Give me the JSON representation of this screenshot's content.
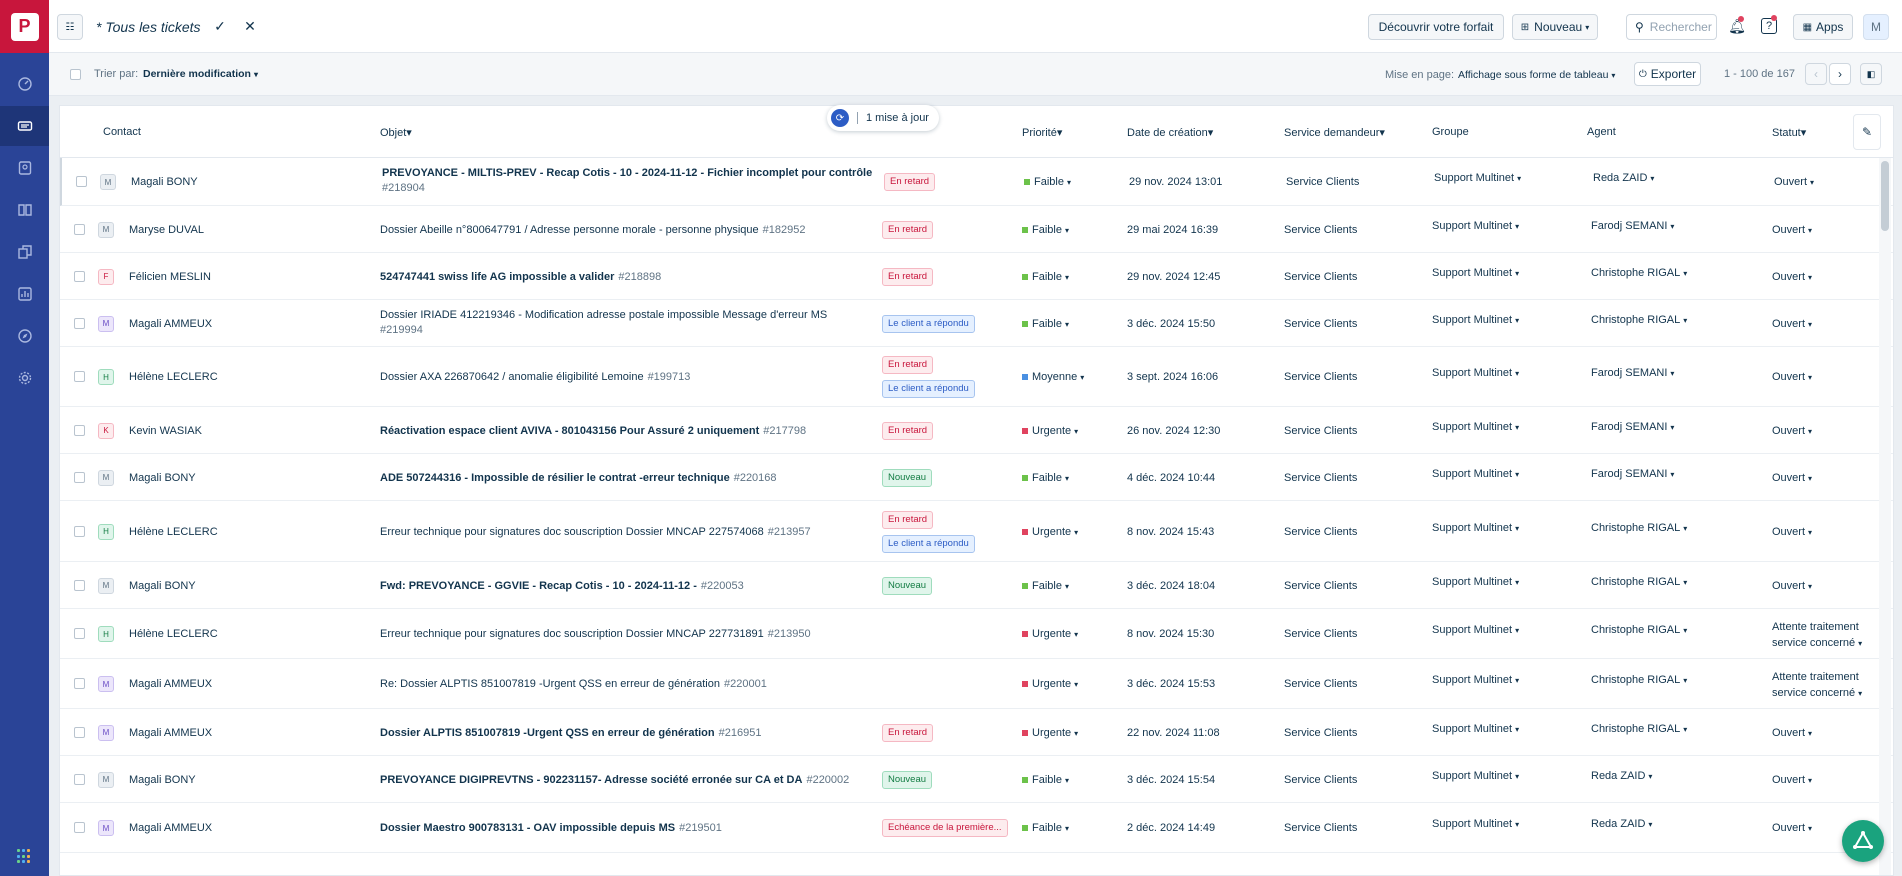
{
  "rail": {
    "logo_letter": "P",
    "items": [
      {
        "icon": "speedometer-icon"
      },
      {
        "icon": "tickets-icon",
        "active": true
      },
      {
        "icon": "contacts-icon"
      },
      {
        "icon": "book-icon"
      },
      {
        "icon": "copy-icon"
      },
      {
        "icon": "chart-icon"
      },
      {
        "icon": "compass-icon"
      },
      {
        "icon": "gear-icon"
      }
    ]
  },
  "topbar": {
    "view_title": "* Tous les tickets",
    "discover_plan": "Découvrir votre forfait",
    "new_label": "Nouveau",
    "search_placeholder": "Rechercher",
    "apps_label": "Apps",
    "avatar_letter": "M"
  },
  "subbar": {
    "sort_label": "Trier par:",
    "sort_value": "Dernière modification",
    "layout_label": "Mise en page:",
    "layout_value": "Affichage sous forme de tableau",
    "export_label": "Exporter",
    "pagination": "1 - 100 de 167"
  },
  "update_pill": {
    "text": "1 mise à jour"
  },
  "columns": {
    "contact": "Contact",
    "objet": "Objet",
    "priorite": "Priorité",
    "date": "Date de création",
    "service": "Service demandeur",
    "groupe": "Groupe",
    "agent": "Agent",
    "statut": "Statut"
  },
  "colors": {
    "late": "#c8163c",
    "reply": "#2c5cc5",
    "new": "#137c43",
    "faible": "#6cc24a",
    "moyenne": "#4a90e2",
    "urgente": "#e0435f"
  },
  "rows": [
    {
      "initial": "M",
      "avatar": "grey",
      "contact": "Magali BONY",
      "subject": "PREVOYANCE - MILTIS-PREV - Recap Cotis - 10 - 2024-11-12 - Fichier incomplet pour contrôle",
      "id": "#218904",
      "bold": true,
      "tags": [
        {
          "t": "En retard",
          "k": "late"
        }
      ],
      "priority": "Faible",
      "pk": "faible",
      "date": "29 nov. 2024 13:01",
      "service": "Service Clients",
      "group": "Support Multinet",
      "agent": "Reda ZAID",
      "status": "Ouvert"
    },
    {
      "initial": "M",
      "avatar": "grey",
      "contact": "Maryse DUVAL",
      "subject": "Dossier Abeille n°800647791 / Adresse personne morale - personne physique",
      "id": "#182952",
      "bold": false,
      "tags": [
        {
          "t": "En retard",
          "k": "late"
        }
      ],
      "priority": "Faible",
      "pk": "faible",
      "date": "29 mai 2024 16:39",
      "service": "Service Clients",
      "group": "Support Multinet",
      "agent": "Farodj SEMANI",
      "status": "Ouvert"
    },
    {
      "initial": "F",
      "avatar": "red",
      "contact": "Félicien MESLIN",
      "subject": "524747441 swiss life AG impossible a valider",
      "id": "#218898",
      "bold": true,
      "tags": [
        {
          "t": "En retard",
          "k": "late"
        }
      ],
      "priority": "Faible",
      "pk": "faible",
      "date": "29 nov. 2024 12:45",
      "service": "Service Clients",
      "group": "Support Multinet",
      "agent": "Christophe RIGAL",
      "status": "Ouvert"
    },
    {
      "initial": "M",
      "avatar": "purple",
      "contact": "Magali AMMEUX",
      "subject": "Dossier IRIADE 412219346 - Modification adresse postale impossible Message d'erreur MS",
      "id": "#219994",
      "bold": false,
      "tags": [
        {
          "t": "Le client a répondu",
          "k": "reply"
        }
      ],
      "priority": "Faible",
      "pk": "faible",
      "date": "3 déc. 2024 15:50",
      "service": "Service Clients",
      "group": "Support Multinet",
      "agent": "Christophe RIGAL",
      "status": "Ouvert"
    },
    {
      "initial": "H",
      "avatar": "green",
      "contact": "Hélène LECLERC",
      "subject": "Dossier AXA 226870642 / anomalie éligibilité Lemoine",
      "id": "#199713",
      "bold": false,
      "tags": [
        {
          "t": "En retard",
          "k": "late"
        },
        {
          "t": "Le client a répondu",
          "k": "reply"
        }
      ],
      "priority": "Moyenne",
      "pk": "moyenne",
      "date": "3 sept. 2024 16:06",
      "service": "Service Clients",
      "group": "Support Multinet",
      "agent": "Farodj SEMANI",
      "status": "Ouvert"
    },
    {
      "initial": "K",
      "avatar": "red",
      "contact": "Kevin WASIAK",
      "subject": "Réactivation espace client AVIVA - 801043156 Pour Assuré 2 uniquement",
      "id": "#217798",
      "bold": true,
      "tags": [
        {
          "t": "En retard",
          "k": "late"
        }
      ],
      "priority": "Urgente",
      "pk": "urgente",
      "date": "26 nov. 2024 12:30",
      "service": "Service Clients",
      "group": "Support Multinet",
      "agent": "Farodj SEMANI",
      "status": "Ouvert"
    },
    {
      "initial": "M",
      "avatar": "grey",
      "contact": "Magali BONY",
      "subject": "ADE 507244316 - Impossible de résilier le contrat -erreur technique",
      "id": "#220168",
      "bold": true,
      "tags": [
        {
          "t": "Nouveau",
          "k": "new"
        }
      ],
      "priority": "Faible",
      "pk": "faible",
      "date": "4 déc. 2024 10:44",
      "service": "Service Clients",
      "group": "Support Multinet",
      "agent": "Farodj SEMANI",
      "status": "Ouvert"
    },
    {
      "initial": "H",
      "avatar": "green",
      "contact": "Hélène LECLERC",
      "subject": "Erreur technique pour signatures doc souscription Dossier MNCAP 227574068",
      "id": "#213957",
      "bold": false,
      "tags": [
        {
          "t": "En retard",
          "k": "late"
        },
        {
          "t": "Le client a répondu",
          "k": "reply"
        }
      ],
      "priority": "Urgente",
      "pk": "urgente",
      "date": "8 nov. 2024 15:43",
      "service": "Service Clients",
      "group": "Support Multinet",
      "agent": "Christophe RIGAL",
      "status": "Ouvert"
    },
    {
      "initial": "M",
      "avatar": "grey",
      "contact": "Magali BONY",
      "subject": "Fwd: PREVOYANCE - GGVIE - Recap Cotis - 10 - 2024-11-12 -",
      "id": "#220053",
      "bold": true,
      "tags": [
        {
          "t": "Nouveau",
          "k": "new"
        }
      ],
      "priority": "Faible",
      "pk": "faible",
      "date": "3 déc. 2024 18:04",
      "service": "Service Clients",
      "group": "Support Multinet",
      "agent": "Christophe RIGAL",
      "status": "Ouvert"
    },
    {
      "initial": "H",
      "avatar": "green",
      "contact": "Hélène LECLERC",
      "subject": "Erreur technique pour signatures doc souscription Dossier MNCAP 227731891",
      "id": "#213950",
      "bold": false,
      "tags": [],
      "priority": "Urgente",
      "pk": "urgente",
      "date": "8 nov. 2024 15:30",
      "service": "Service Clients",
      "group": "Support Multinet",
      "agent": "Christophe RIGAL",
      "status": "Attente traitement service concerné"
    },
    {
      "initial": "M",
      "avatar": "purple",
      "contact": "Magali AMMEUX",
      "subject": "Re: Dossier ALPTIS 851007819 -Urgent QSS en erreur de génération",
      "id": "#220001",
      "bold": false,
      "tags": [],
      "priority": "Urgente",
      "pk": "urgente",
      "date": "3 déc. 2024 15:53",
      "service": "Service Clients",
      "group": "Support Multinet",
      "agent": "Christophe RIGAL",
      "status": "Attente traitement service concerné"
    },
    {
      "initial": "M",
      "avatar": "purple",
      "contact": "Magali AMMEUX",
      "subject": "Dossier ALPTIS 851007819 -Urgent QSS en erreur de génération",
      "id": "#216951",
      "bold": true,
      "tags": [
        {
          "t": "En retard",
          "k": "late"
        }
      ],
      "priority": "Urgente",
      "pk": "urgente",
      "date": "22 nov. 2024 11:08",
      "service": "Service Clients",
      "group": "Support Multinet",
      "agent": "Christophe RIGAL",
      "status": "Ouvert"
    },
    {
      "initial": "M",
      "avatar": "grey",
      "contact": "Magali BONY",
      "subject": "PREVOYANCE DIGIPREVTNS - 902231157- Adresse société erronée sur CA et DA",
      "id": "#220002",
      "bold": true,
      "tags": [
        {
          "t": "Nouveau",
          "k": "new"
        }
      ],
      "priority": "Faible",
      "pk": "faible",
      "date": "3 déc. 2024 15:54",
      "service": "Service Clients",
      "group": "Support Multinet",
      "agent": "Reda ZAID",
      "status": "Ouvert"
    },
    {
      "initial": "M",
      "avatar": "purple",
      "contact": "Magali AMMEUX",
      "subject": "Dossier Maestro 900783131 - OAV impossible depuis MS",
      "id": "#219501",
      "bold": true,
      "tags": [
        {
          "t": "Echéance de la première...",
          "k": "late"
        }
      ],
      "priority": "Faible",
      "pk": "faible",
      "date": "2 déc. 2024 14:49",
      "service": "Service Clients",
      "group": "Support Multinet",
      "agent": "Reda ZAID",
      "status": "Ouvert"
    }
  ]
}
